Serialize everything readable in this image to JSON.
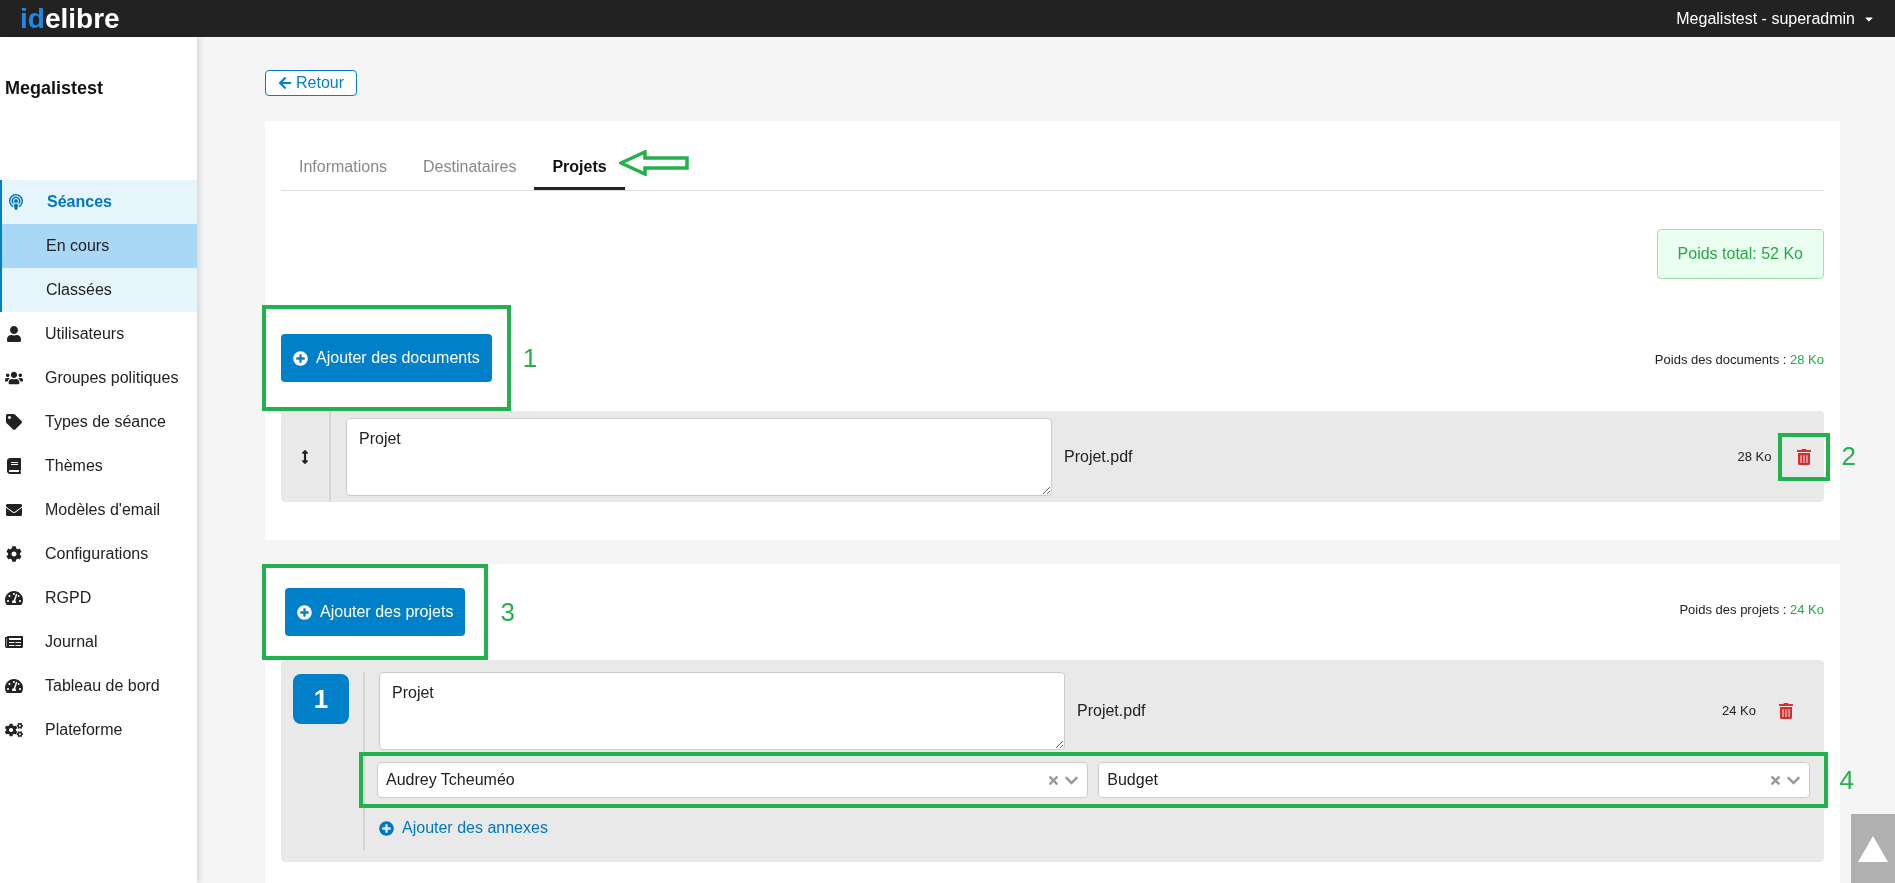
{
  "header": {
    "logo_prefix": "id",
    "logo_suffix": "elibre",
    "user_menu": "Megalistest - superadmin"
  },
  "sidebar": {
    "title": "Megalistest",
    "items": [
      {
        "label": "Séances",
        "expanded": true,
        "children": [
          {
            "label": "En cours",
            "selected": true
          },
          {
            "label": "Classées",
            "selected": false
          }
        ]
      },
      {
        "label": "Utilisateurs"
      },
      {
        "label": "Groupes politiques"
      },
      {
        "label": "Types de séance"
      },
      {
        "label": "Thèmes"
      },
      {
        "label": "Modèles d'email"
      },
      {
        "label": "Configurations"
      },
      {
        "label": "RGPD"
      },
      {
        "label": "Journal"
      },
      {
        "label": "Tableau de bord"
      },
      {
        "label": "Plateforme"
      }
    ]
  },
  "back_button": "Retour",
  "tabs": [
    {
      "label": "Informations",
      "selected": false
    },
    {
      "label": "Destinataires",
      "selected": false
    },
    {
      "label": "Projets",
      "selected": true
    }
  ],
  "total_weight": "Poids total: 52 Ko",
  "documents": {
    "add_button": "Ajouter des documents",
    "annotation": "1",
    "weight_label": "Poids des documents :",
    "weight_value": "28 Ko",
    "items": [
      {
        "title": "Projet",
        "file": "Projet.pdf",
        "size": "28 Ko",
        "annotation": "2"
      }
    ]
  },
  "projects": {
    "add_button": "Ajouter des projets",
    "annotation": "3",
    "weight_label": "Poids des projets :",
    "weight_value": "24 Ko",
    "items": [
      {
        "number": "1",
        "title": "Projet",
        "file": "Projet.pdf",
        "size": "24 Ko",
        "rapporteur": "Audrey Tcheuméo",
        "theme": "Budget",
        "annotation": "4",
        "add_annex": "Ajouter des annexes"
      }
    ]
  }
}
